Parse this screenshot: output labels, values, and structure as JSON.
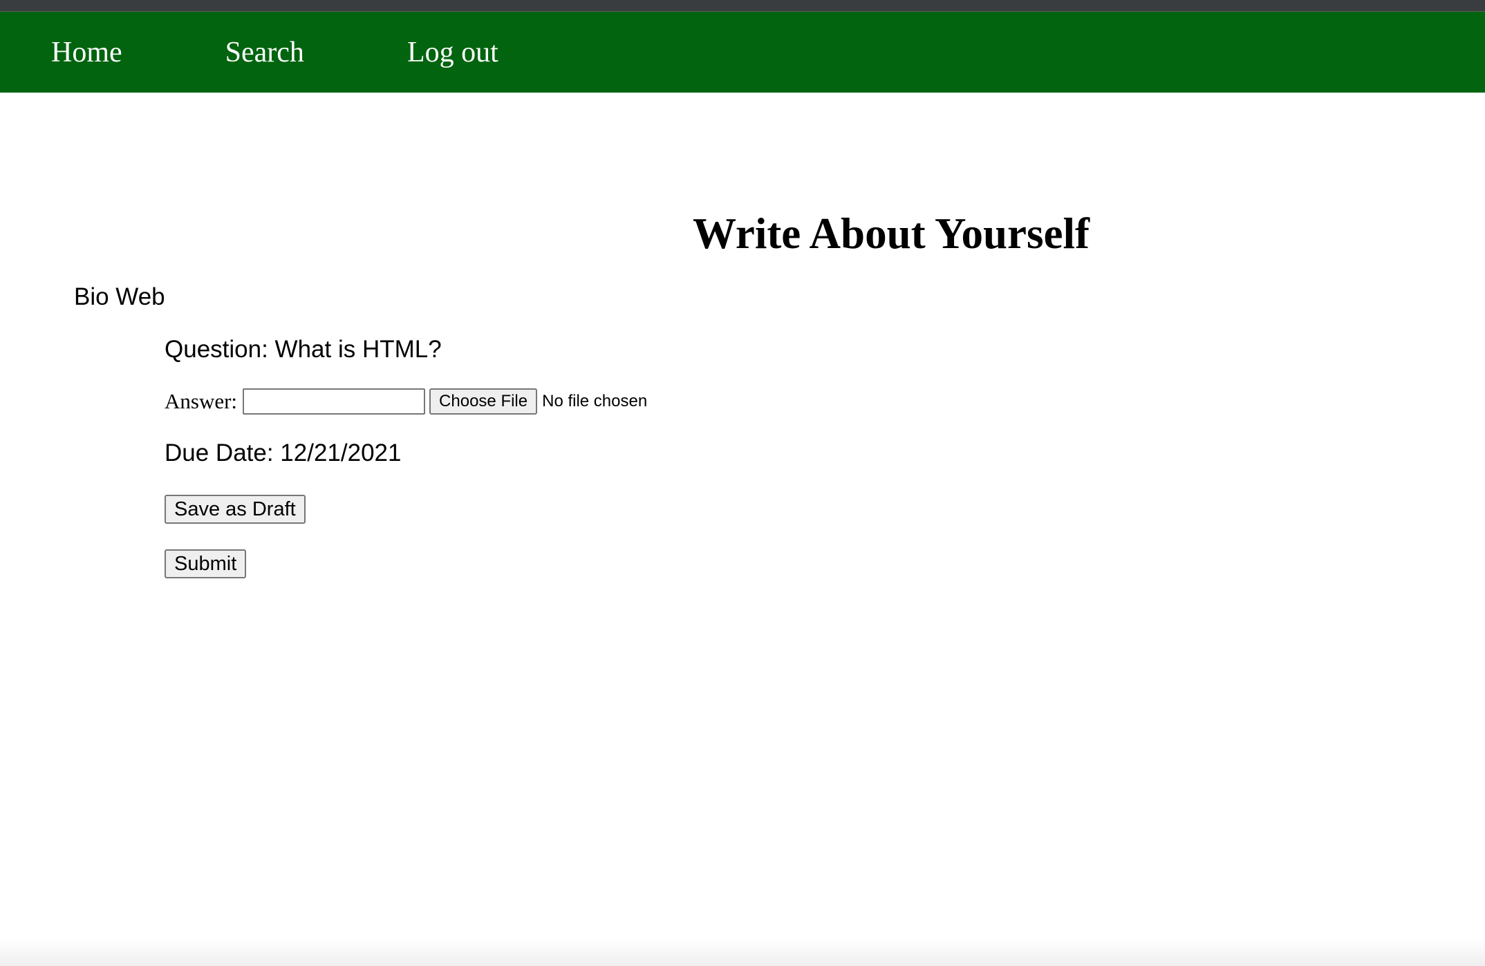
{
  "nav": {
    "items": [
      {
        "label": "Home"
      },
      {
        "label": "Search"
      },
      {
        "label": "Log out"
      }
    ]
  },
  "page": {
    "title": "Write About Yourself",
    "section": "Bio Web"
  },
  "assignment": {
    "question": "Question: What is HTML?",
    "answer_label": "Answer:",
    "answer_value": "",
    "file_button_label": "Choose File",
    "file_status": "No file chosen",
    "due_date": "Due Date: 12/21/2021"
  },
  "actions": {
    "draft_label": "Save as Draft",
    "submit_label": "Submit"
  },
  "colors": {
    "navbar": "#02640f",
    "top_strip": "#3a3d3f"
  }
}
